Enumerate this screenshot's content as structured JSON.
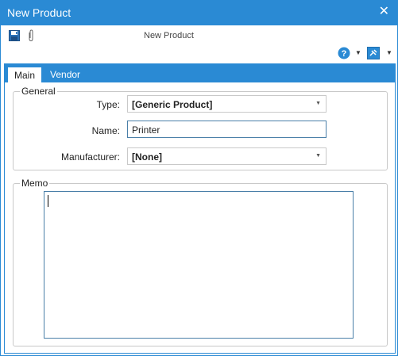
{
  "window": {
    "title": "New Product",
    "close_glyph": "✕"
  },
  "toolbar": {
    "doc_title": "New Product",
    "icons": [
      "save-icon",
      "attachment-icon",
      "help-icon",
      "pin-icon"
    ]
  },
  "tabs": [
    {
      "label": "Main",
      "active": true
    },
    {
      "label": "Vendor",
      "active": false
    }
  ],
  "general": {
    "legend": "General",
    "type_label": "Type:",
    "type_value": "[Generic Product]",
    "name_label": "Name:",
    "name_value": "Printer",
    "manufacturer_label": "Manufacturer:",
    "manufacturer_value": "[None]"
  },
  "memo": {
    "legend": "Memo",
    "value": ""
  },
  "colors": {
    "accent": "#2a8ad4",
    "help": "#2a8ad4"
  }
}
